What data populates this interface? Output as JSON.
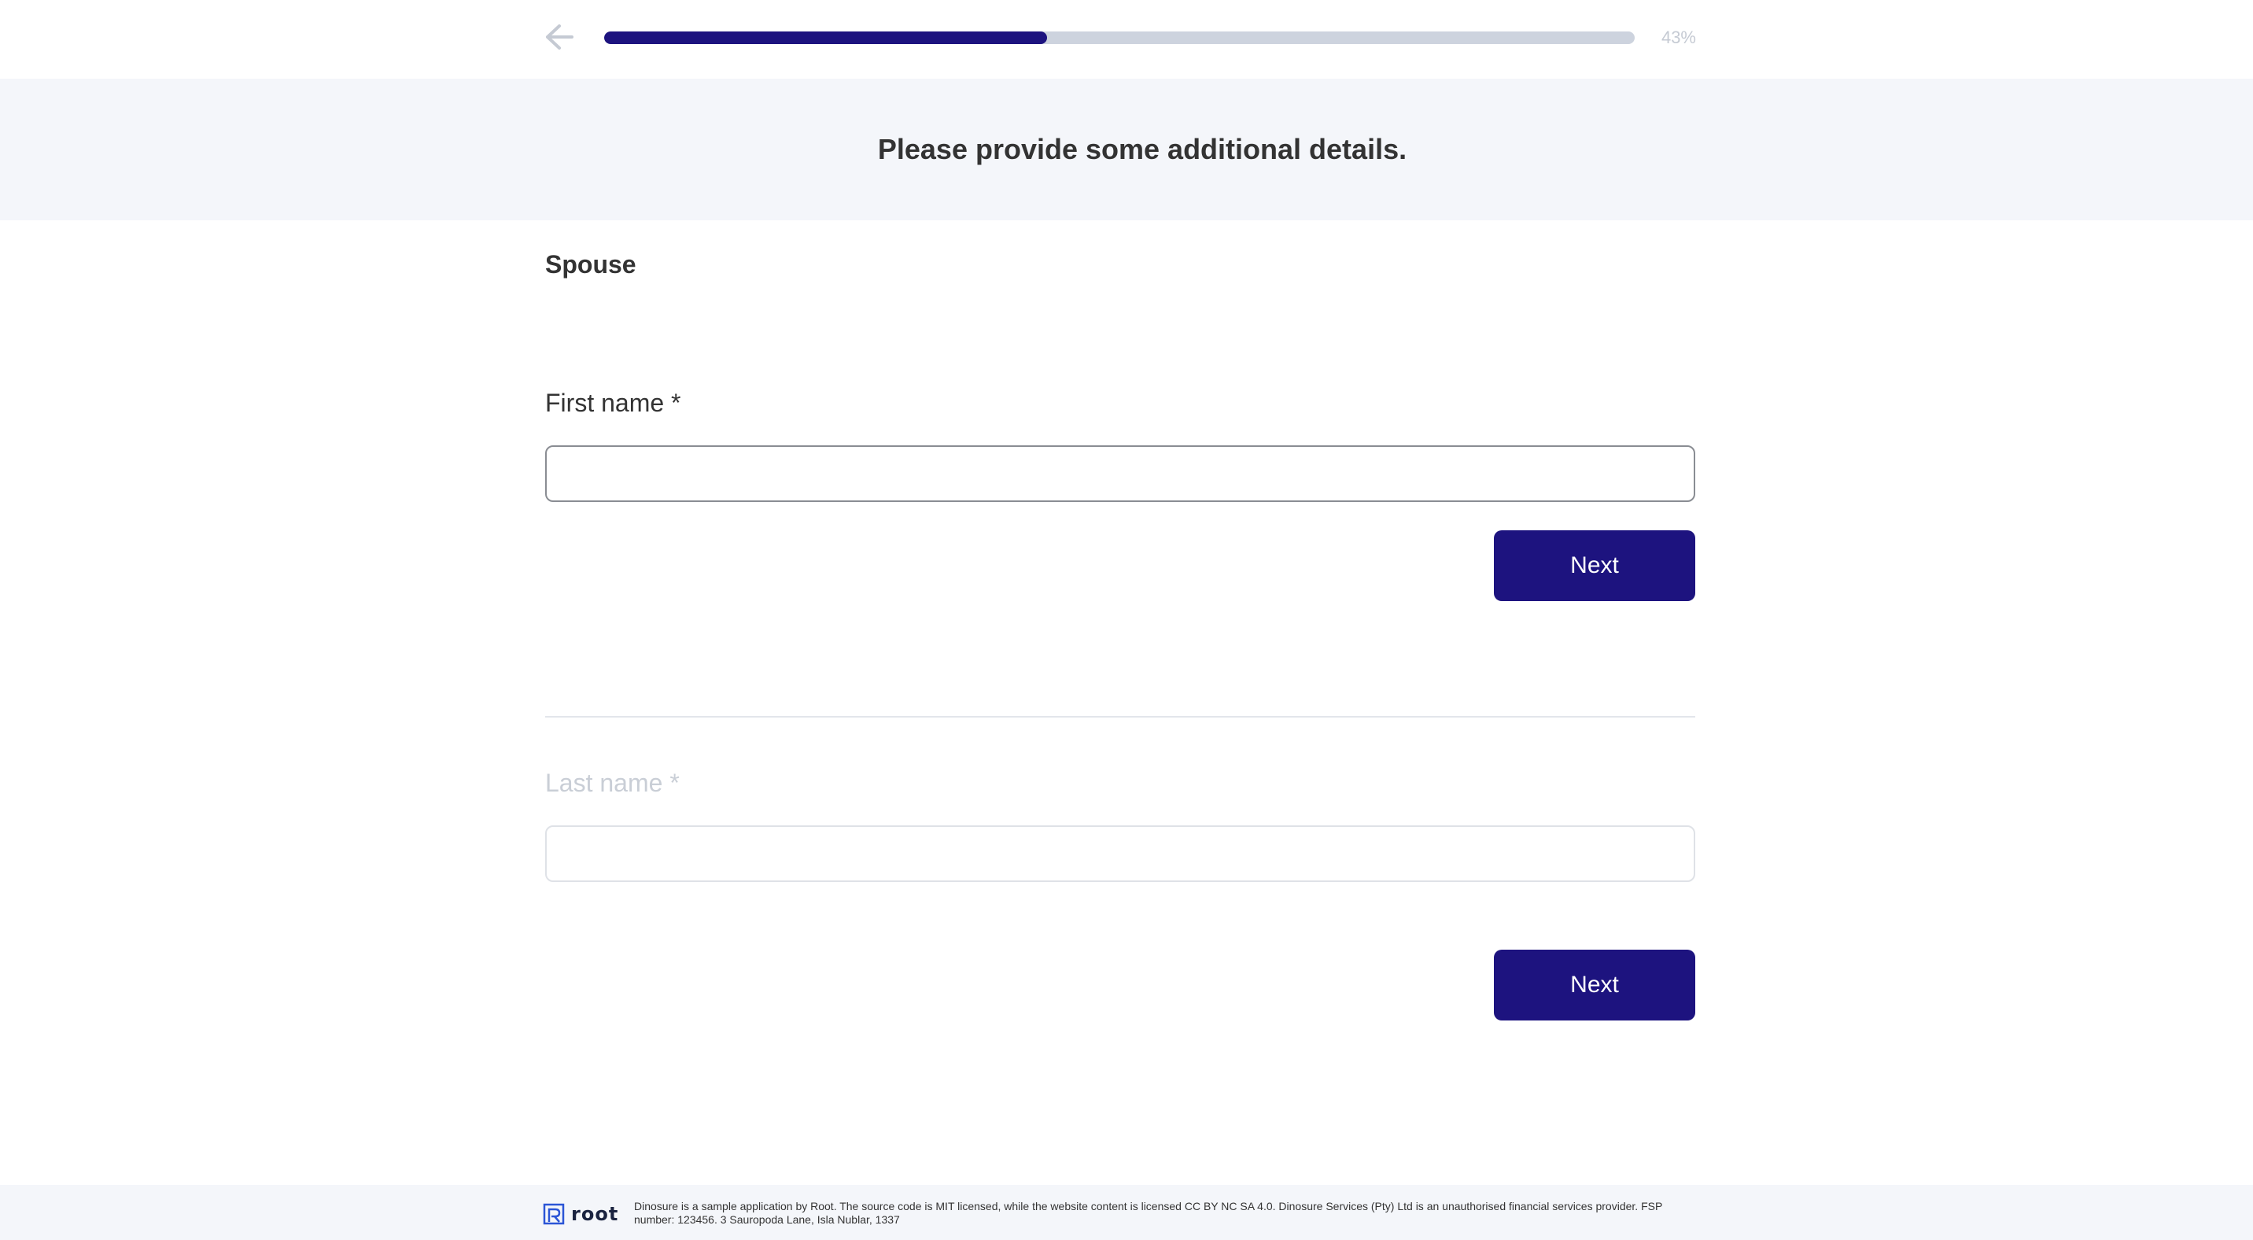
{
  "progress": {
    "value": 0.43,
    "label": "43%"
  },
  "header": {
    "title": "Please provide some additional details."
  },
  "section": {
    "title": "Spouse"
  },
  "fields": {
    "first_name": {
      "label": "First name *",
      "value": "",
      "placeholder": ""
    },
    "last_name": {
      "label": "Last name *",
      "value": "",
      "placeholder": ""
    }
  },
  "buttons": {
    "next_label": "Next"
  },
  "footer": {
    "logo_text": "root",
    "disclaimer": "Dinosure is a sample application by Root. The source code is MIT licensed, while the website content is licensed CC BY NC SA 4.0. Dinosure Services (Pty) Ltd is an unauthorised financial services provider. FSP number: 123456. 3 Sauropoda Lane, Isla Nublar, 1337"
  },
  "colors": {
    "accent": "#1d137f",
    "track": "#cdd3de",
    "band": "#f4f6fa"
  },
  "icons": {
    "back": "arrow-left-icon",
    "logo": "root-logo-icon"
  }
}
